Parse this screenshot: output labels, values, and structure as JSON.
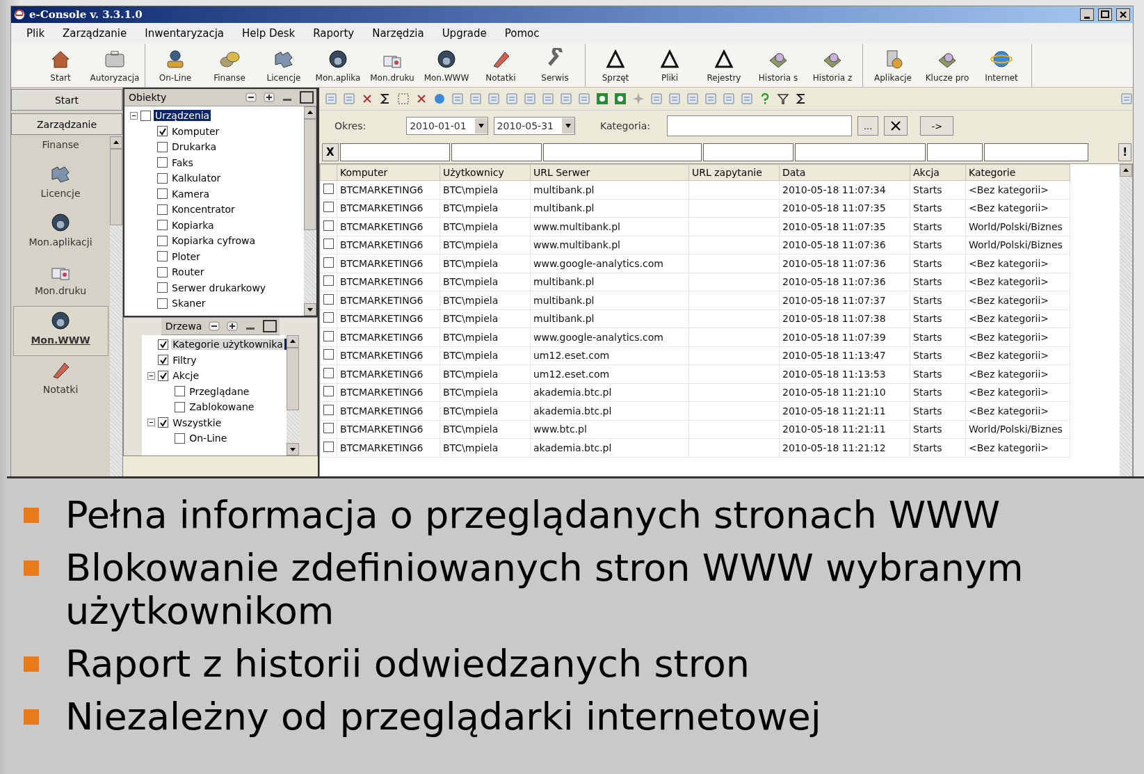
{
  "window": {
    "title": "e-Console v. 3.3.1.0"
  },
  "menu": [
    "Plik",
    "Zarządzanie",
    "Inwentaryzacja",
    "Help Desk",
    "Raporty",
    "Narzędzia",
    "Upgrade",
    "Pomoc"
  ],
  "toolbar": [
    [
      "Start",
      "Autoryzacja"
    ],
    [
      "On-Line",
      "Finanse",
      "Licencje",
      "Mon.aplika",
      "Mon.druku",
      "Mon.WWW",
      "Notatki",
      "Serwis"
    ],
    [
      "Sprzęt",
      "Pliki",
      "Rejestry",
      "Historia s",
      "Historia z"
    ],
    [
      "Aplikacje",
      "Klucze pro",
      "Internet"
    ]
  ],
  "nav": {
    "buttons": [
      "Start",
      "Zarządzanie"
    ],
    "items": [
      {
        "label": "Finanse",
        "selected": false
      },
      {
        "label": "Licencje",
        "selected": false
      },
      {
        "label": "Mon.aplikacji",
        "selected": false
      },
      {
        "label": "Mon.druku",
        "selected": false
      },
      {
        "label": "Mon.WWW",
        "selected": true
      },
      {
        "label": "Notatki",
        "selected": false
      }
    ]
  },
  "trees": [
    {
      "title": "Obiekty",
      "nodes": [
        {
          "label": "Urządzenia",
          "checked": false,
          "selected": true,
          "expanded": true,
          "children": [
            {
              "label": "Komputer",
              "checked": true,
              "selected": false
            },
            {
              "label": "Drukarka",
              "checked": false,
              "selected": false
            },
            {
              "label": "Faks",
              "checked": false,
              "selected": false
            },
            {
              "label": "Kalkulator",
              "checked": false,
              "selected": false
            },
            {
              "label": "Kamera",
              "checked": false,
              "selected": false
            },
            {
              "label": "Koncentrator",
              "checked": false,
              "selected": false
            },
            {
              "label": "Kopiarka",
              "checked": false,
              "selected": false
            },
            {
              "label": "Kopiarka cyfrowa",
              "checked": false,
              "selected": false
            },
            {
              "label": "Ploter",
              "checked": false,
              "selected": false
            },
            {
              "label": "Router",
              "checked": false,
              "selected": false
            },
            {
              "label": "Serwer drukarkowy",
              "checked": false,
              "selected": false
            },
            {
              "label": "Skaner",
              "checked": false,
              "selected": false
            }
          ]
        }
      ]
    },
    {
      "title": "Drzewa",
      "nodes": [
        {
          "label": "Kategorie użytkownika",
          "checked": true,
          "selected": true
        },
        {
          "label": "Filtry",
          "checked": true,
          "selected": false
        },
        {
          "label": "Akcje",
          "checked": true,
          "selected": false,
          "expanded": true,
          "children": [
            {
              "label": "Przeglądane",
              "checked": false,
              "selected": false
            },
            {
              "label": "Zablokowane",
              "checked": false,
              "selected": false
            }
          ]
        },
        {
          "label": "Wszystkie",
          "checked": true,
          "selected": false,
          "expanded": true,
          "children": [
            {
              "label": "On-Line",
              "checked": false,
              "selected": false
            }
          ]
        }
      ]
    }
  ],
  "filter": {
    "period_label": "Okres:",
    "date_from": "2010-01-01",
    "date_to": "2010-05-31",
    "category_label": "Kategoria:",
    "browse_button": "...",
    "go_button": "->"
  },
  "column_filter": {
    "clear_button": "X",
    "apply_button": "!"
  },
  "table": {
    "columns": [
      "Komputer",
      "Użytkownicy",
      "URL Serwer",
      "URL zapytanie",
      "Data",
      "Akcja",
      "Kategorie"
    ],
    "rows": [
      {
        "checked": false,
        "cells": [
          "BTCMARKETING6",
          "BTC\\mpiela",
          "multibank.pl",
          "",
          "2010-05-18 11:07:34",
          "Starts",
          "<Bez kategorii>"
        ]
      },
      {
        "checked": false,
        "cells": [
          "BTCMARKETING6",
          "BTC\\mpiela",
          "multibank.pl",
          "",
          "2010-05-18 11:07:35",
          "Starts",
          "<Bez kategorii>"
        ]
      },
      {
        "checked": false,
        "cells": [
          "BTCMARKETING6",
          "BTC\\mpiela",
          "www.multibank.pl",
          "",
          "2010-05-18 11:07:35",
          "Starts",
          "World/Polski/Biznes"
        ]
      },
      {
        "checked": false,
        "cells": [
          "BTCMARKETING6",
          "BTC\\mpiela",
          "www.multibank.pl",
          "",
          "2010-05-18 11:07:36",
          "Starts",
          "World/Polski/Biznes"
        ]
      },
      {
        "checked": false,
        "cells": [
          "BTCMARKETING6",
          "BTC\\mpiela",
          "www.google-analytics.com",
          "",
          "2010-05-18 11:07:36",
          "Starts",
          "<Bez kategorii>"
        ]
      },
      {
        "checked": false,
        "cells": [
          "BTCMARKETING6",
          "BTC\\mpiela",
          "multibank.pl",
          "",
          "2010-05-18 11:07:36",
          "Starts",
          "<Bez kategorii>"
        ]
      },
      {
        "checked": false,
        "cells": [
          "BTCMARKETING6",
          "BTC\\mpiela",
          "multibank.pl",
          "",
          "2010-05-18 11:07:37",
          "Starts",
          "<Bez kategorii>"
        ]
      },
      {
        "checked": false,
        "cells": [
          "BTCMARKETING6",
          "BTC\\mpiela",
          "multibank.pl",
          "",
          "2010-05-18 11:07:38",
          "Starts",
          "<Bez kategorii>"
        ]
      },
      {
        "checked": false,
        "cells": [
          "BTCMARKETING6",
          "BTC\\mpiela",
          "www.google-analytics.com",
          "",
          "2010-05-18 11:07:39",
          "Starts",
          "<Bez kategorii>"
        ]
      },
      {
        "checked": false,
        "cells": [
          "BTCMARKETING6",
          "BTC\\mpiela",
          "um12.eset.com",
          "",
          "2010-05-18 11:13:47",
          "Starts",
          "<Bez kategorii>"
        ]
      },
      {
        "checked": false,
        "cells": [
          "BTCMARKETING6",
          "BTC\\mpiela",
          "um12.eset.com",
          "",
          "2010-05-18 11:13:53",
          "Starts",
          "<Bez kategorii>"
        ]
      },
      {
        "checked": false,
        "cells": [
          "BTCMARKETING6",
          "BTC\\mpiela",
          "akademia.btc.pl",
          "",
          "2010-05-18 11:21:10",
          "Starts",
          "<Bez kategorii>"
        ]
      },
      {
        "checked": false,
        "cells": [
          "BTCMARKETING6",
          "BTC\\mpiela",
          "akademia.btc.pl",
          "",
          "2010-05-18 11:21:11",
          "Starts",
          "<Bez kategorii>"
        ]
      },
      {
        "checked": false,
        "cells": [
          "BTCMARKETING6",
          "BTC\\mpiela",
          "www.btc.pl",
          "",
          "2010-05-18 11:21:11",
          "Starts",
          "World/Polski/Biznes"
        ]
      },
      {
        "checked": false,
        "cells": [
          "BTCMARKETING6",
          "BTC\\mpiela",
          "akademia.btc.pl",
          "",
          "2010-05-18 11:21:12",
          "Starts",
          "<Bez kategorii>"
        ]
      }
    ]
  },
  "bullets": [
    "Pełna informacja o przeglądanych stronach WWW",
    "Blokowanie zdefiniowanych stron WWW wybranym użytkownikom",
    "Raport z historii odwiedzanych stron",
    "Niezależny od przeglądarki internetowej"
  ]
}
